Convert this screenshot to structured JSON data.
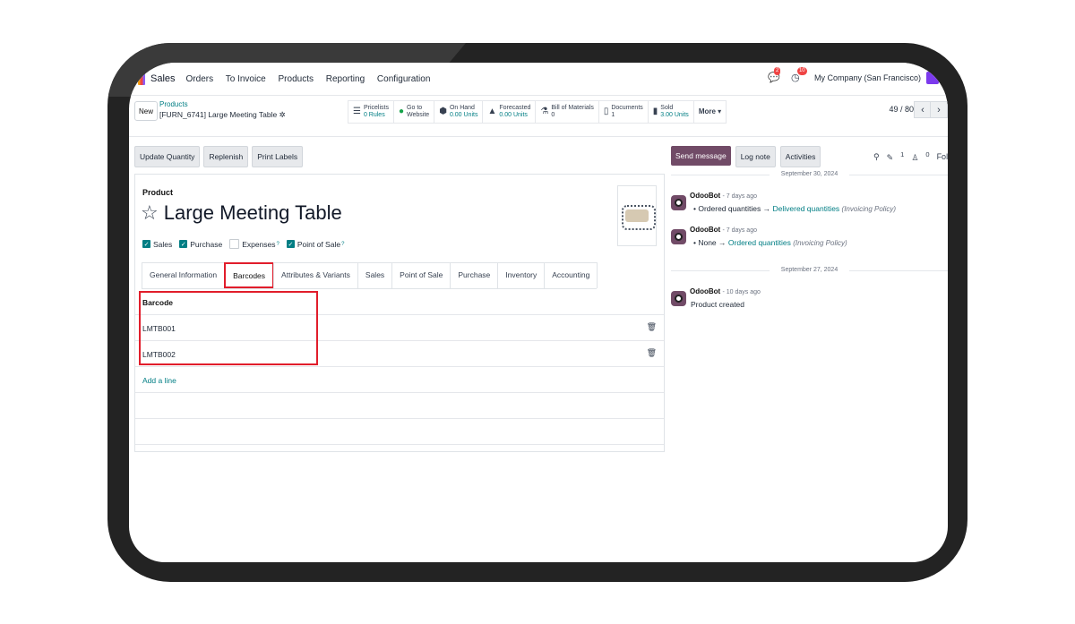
{
  "nav": {
    "app_name": "Sales",
    "menu": [
      "Orders",
      "To Invoice",
      "Products",
      "Reporting",
      "Configuration"
    ],
    "messages_count": "2",
    "activities_count": "10",
    "company": "My Company (San Francisco)"
  },
  "control_panel": {
    "new_label": "New",
    "breadcrumb_link": "Products",
    "record_name": "[FURN_6741] Large Meeting Table",
    "smart_buttons": [
      {
        "icon": "list-icon",
        "glyph": "☰",
        "label": "Pricelists",
        "value": "0 Rules"
      },
      {
        "icon": "globe-icon",
        "glyph": "●",
        "label": "Go to",
        "value": "Website"
      },
      {
        "icon": "cubes-icon",
        "glyph": "⬢",
        "label": "On Hand",
        "value": "0.00 Units"
      },
      {
        "icon": "area-chart-icon",
        "glyph": "▲",
        "label": "Forecasted",
        "value": "0.00 Units"
      },
      {
        "icon": "flask-icon",
        "glyph": "⚗",
        "label": "Bill of Materials",
        "value": "0"
      },
      {
        "icon": "file-icon",
        "glyph": "▯",
        "label": "Documents",
        "value": "1"
      },
      {
        "icon": "signal-icon",
        "glyph": "▮",
        "label": "Sold",
        "value": "3.00 Units"
      }
    ],
    "more_label": "More ▾",
    "pager": "49 / 80"
  },
  "action_buttons": [
    "Update Quantity",
    "Replenish",
    "Print Labels"
  ],
  "form": {
    "product_label": "Product",
    "title": "Large Meeting Table",
    "checkboxes": [
      {
        "label": "Sales",
        "checked": true
      },
      {
        "label": "Purchase",
        "checked": true
      },
      {
        "label": "Expenses",
        "checked": false,
        "help": "?"
      },
      {
        "label": "Point of Sale",
        "checked": true,
        "help": "?"
      }
    ],
    "tabs": [
      "General Information",
      "Barcodes",
      "Attributes & Variants",
      "Sales",
      "Point of Sale",
      "Purchase",
      "Inventory",
      "Accounting"
    ],
    "active_tab": "Barcodes",
    "barcode_header": "Barcode",
    "barcodes": [
      "LMTB001",
      "LMTB002"
    ],
    "add_line": "Add a line"
  },
  "chatter": {
    "send_message": "Send message",
    "log_note": "Log note",
    "activities": "Activities",
    "attachments_count": "1",
    "followers_count": "0",
    "follow": "Follow",
    "date1": "September 30, 2024",
    "date2": "September 27, 2024",
    "messages": [
      {
        "author": "OdooBot",
        "time": "- 7 days ago",
        "old": "Ordered quantities",
        "new": "Delivered quantities",
        "field": "(Invoicing Policy)"
      },
      {
        "author": "OdooBot",
        "time": "- 7 days ago",
        "old": "None",
        "new": "Ordered quantities",
        "field": "(Invoicing Policy)"
      },
      {
        "author": "OdooBot",
        "time": "- 10 days ago",
        "body": "Product created"
      }
    ]
  }
}
